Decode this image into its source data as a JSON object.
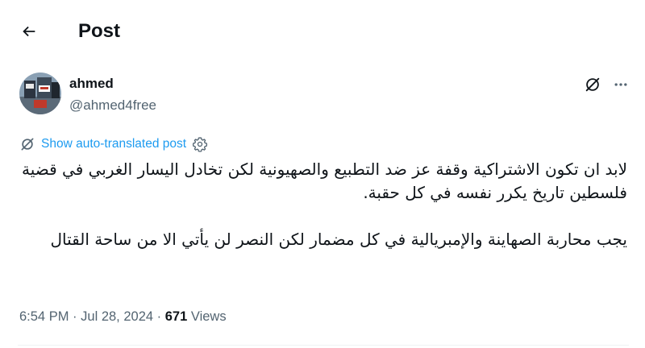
{
  "header": {
    "title": "Post",
    "back_icon": "arrow-left-icon"
  },
  "author": {
    "name": "ahmed",
    "handle": "@ahmed4free",
    "avatar_icon": "profile-photo"
  },
  "actions": {
    "grok_icon": "grok-icon",
    "more_icon": "more-dots-icon"
  },
  "translate": {
    "label": "Show auto-translated post",
    "icon": "translate-icon",
    "settings_icon": "gear-icon"
  },
  "post": {
    "paragraph_1": "لابد ان تكون الاشتراكية وقفة عز ضد التطبيع والصهيونية لكن تخادل اليسار الغربي في قضية فلسطين تاريخ يكرر نفسه في كل حقبة.",
    "paragraph_2": "يجب محاربة الصهاينة والإمبريالية في كل مضمار لكن النصر لن يأتي الا من ساحة القتال"
  },
  "meta": {
    "time": "6:54 PM",
    "separator": "·",
    "date": "Jul 28, 2024",
    "views_count": "671",
    "views_label": "Views"
  },
  "colors": {
    "accent": "#1d9bf0",
    "text": "#0f1419",
    "secondary": "#536471",
    "divider": "#eff3f4"
  }
}
